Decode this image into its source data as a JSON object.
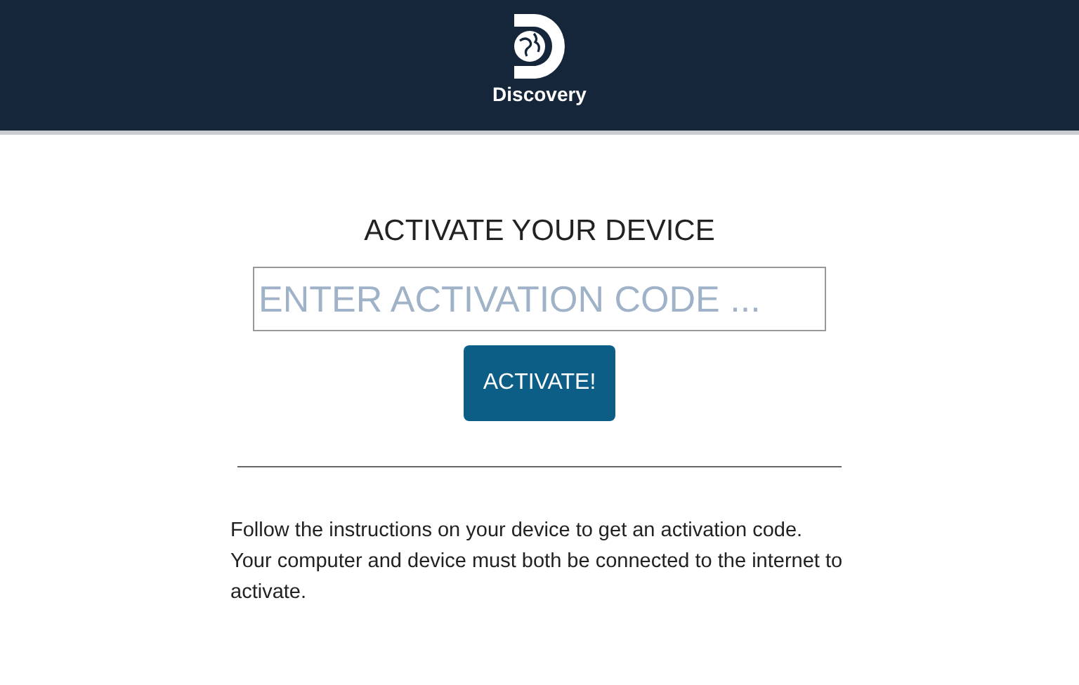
{
  "header": {
    "logo_text": "Discovery"
  },
  "heading": "ACTIVATE YOUR DEVICE",
  "code_field": {
    "placeholder": "ENTER ACTIVATION CODE ..."
  },
  "button": "ACTIVATE!",
  "instructions": [
    "Follow the instructions on your device to get an activation code.",
    "Your computer and device must both be connected to the internet to activate."
  ]
}
